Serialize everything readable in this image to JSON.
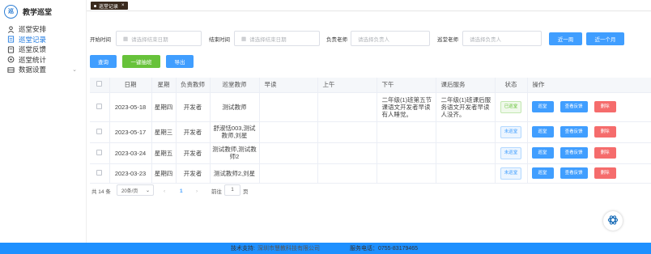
{
  "app": {
    "title": "教学巡堂",
    "logo_text": "巡"
  },
  "sidebar": {
    "items": [
      {
        "label": "巡堂安排",
        "icon": "user-icon"
      },
      {
        "label": "巡堂记录",
        "icon": "document-icon",
        "active": true
      },
      {
        "label": "巡堂反馈",
        "icon": "feedback-icon"
      },
      {
        "label": "巡堂统计",
        "icon": "stats-icon"
      },
      {
        "label": "数据设置",
        "icon": "settings-icon",
        "expandable": true
      }
    ]
  },
  "tabs": [
    {
      "label": "巡堂记录",
      "close": "×"
    }
  ],
  "filters": {
    "start_label": "开始时间",
    "start_placeholder": "请选择结束日期",
    "end_label": "结束时间",
    "end_placeholder": "请选择结束日期",
    "teacher_label": "负责老师",
    "teacher_placeholder": "请选择负责人",
    "patrol_label": "巡堂老师",
    "patrol_placeholder": "请选择负责人",
    "last_week": "近一周",
    "last_month": "近一个月"
  },
  "actions": {
    "query": "查询",
    "batch": "一键抽班",
    "export": "导出"
  },
  "table": {
    "headers": [
      "日期",
      "星期",
      "负责教师",
      "巡堂教师",
      "早读",
      "上午",
      "下午",
      "课后服务",
      "状态",
      "操作"
    ],
    "rows": [
      {
        "date": "2023-05-18",
        "weekday": "星期四",
        "teacher": "开发者",
        "patrol": "测试教师",
        "morning": "",
        "am": "",
        "pm": "二年级(1)班第五节课语文开发者早读有人睡觉。",
        "after": "二年级(1)班课后服务语文开发者早读人没齐。",
        "status": "已巡堂",
        "status_type": "done"
      },
      {
        "date": "2023-05-17",
        "weekday": "星期三",
        "teacher": "开发者",
        "patrol": "舒淑恬003,测试教师,刘星",
        "morning": "",
        "am": "",
        "pm": "",
        "after": "",
        "status": "未巡堂",
        "status_type": "todo"
      },
      {
        "date": "2023-03-24",
        "weekday": "星期五",
        "teacher": "开发者",
        "patrol": "测试教师,测试教师2",
        "morning": "",
        "am": "",
        "pm": "",
        "after": "",
        "status": "未巡堂",
        "status_type": "todo"
      },
      {
        "date": "2023-03-23",
        "weekday": "星期四",
        "teacher": "开发者",
        "patrol": "测试教师2,刘星",
        "morning": "",
        "am": "",
        "pm": "",
        "after": "",
        "status": "未巡堂",
        "status_type": "todo"
      }
    ],
    "op_labels": {
      "inspect": "巡堂",
      "view": "查看反馈",
      "delete": "删除"
    }
  },
  "pagination": {
    "total": "共 14 条",
    "page_size": "20条/页",
    "prev": "‹",
    "current": "1",
    "next": "›",
    "goto_label": "前往",
    "goto_value": "1",
    "page_unit": "页"
  },
  "footer": {
    "support_label": "技术支持:",
    "support_company": "深圳市慧教科技有限公司",
    "phone_label": "服务电话：0755-83179465"
  },
  "colors": {
    "primary": "#409eff",
    "success": "#67c23a",
    "danger": "#f56c6c",
    "footer": "#1e90ff",
    "active_menu": "#1f7ae0"
  }
}
